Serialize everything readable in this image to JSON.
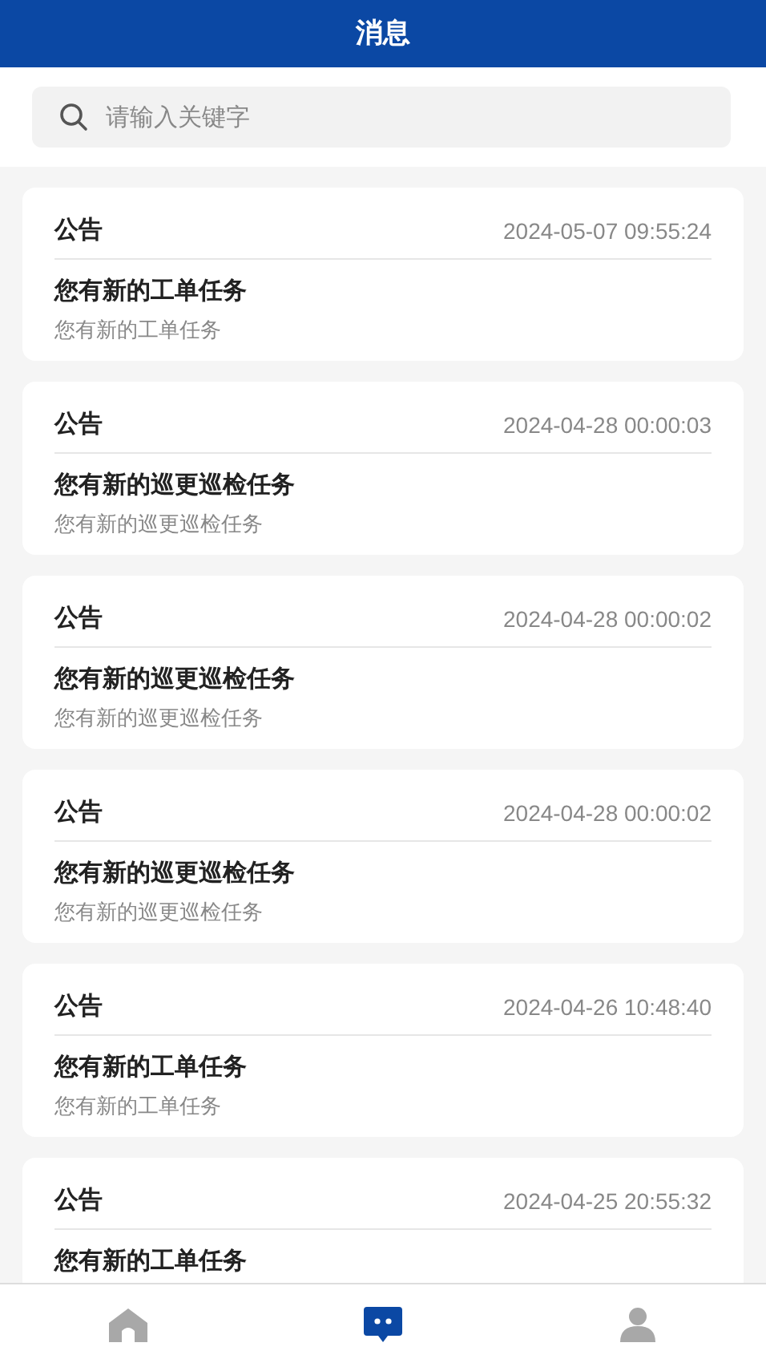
{
  "header": {
    "title": "消息"
  },
  "search": {
    "placeholder": "请输入关键字"
  },
  "messages": [
    {
      "category": "公告",
      "time": "2024-05-07 09:55:24",
      "title": "您有新的工单任务",
      "subtitle": "您有新的工单任务"
    },
    {
      "category": "公告",
      "time": "2024-04-28 00:00:03",
      "title": "您有新的巡更巡检任务",
      "subtitle": "您有新的巡更巡检任务"
    },
    {
      "category": "公告",
      "time": "2024-04-28 00:00:02",
      "title": "您有新的巡更巡检任务",
      "subtitle": "您有新的巡更巡检任务"
    },
    {
      "category": "公告",
      "time": "2024-04-28 00:00:02",
      "title": "您有新的巡更巡检任务",
      "subtitle": "您有新的巡更巡检任务"
    },
    {
      "category": "公告",
      "time": "2024-04-26 10:48:40",
      "title": "您有新的工单任务",
      "subtitle": "您有新的工单任务"
    },
    {
      "category": "公告",
      "time": "2024-04-25 20:55:32",
      "title": "您有新的工单任务"
    }
  ],
  "tab_bar": [
    {
      "kind": "home",
      "selected": false
    },
    {
      "kind": "messages",
      "selected": true
    },
    {
      "kind": "profile",
      "selected": false
    }
  ]
}
